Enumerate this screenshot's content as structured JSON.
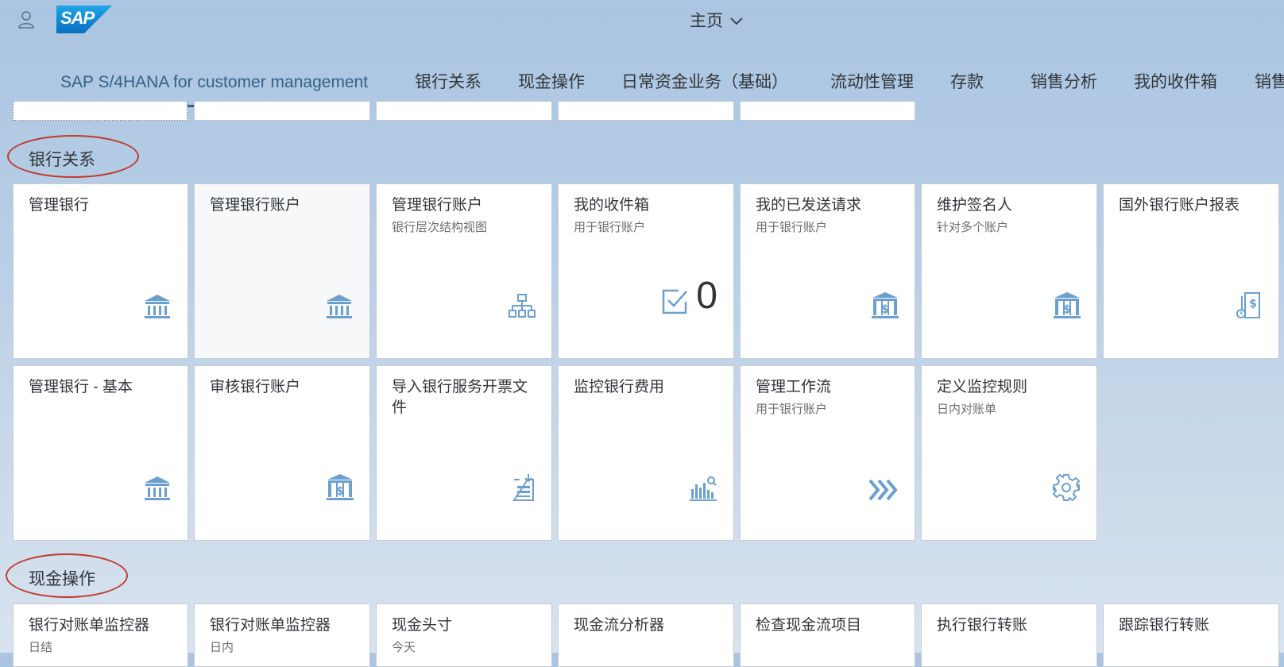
{
  "shell": {
    "logo_text": "SAP",
    "home_title": "主页"
  },
  "tabs": [
    {
      "label": "SAP S/4HANA for customer management",
      "active": true
    },
    {
      "label": "银行关系"
    },
    {
      "label": "现金操作"
    },
    {
      "label": "日常资金业务（基础）"
    },
    {
      "label": "流动性管理"
    },
    {
      "label": "存款"
    },
    {
      "label": "销售分析"
    },
    {
      "label": "我的收件箱"
    },
    {
      "label": "销售"
    }
  ],
  "groups": [
    {
      "title": "银行关系",
      "tiles": [
        {
          "title": "管理银行",
          "subtitle": "",
          "icon": "bank-icon"
        },
        {
          "title": "管理银行账户",
          "subtitle": "",
          "icon": "bank-icon"
        },
        {
          "title": "管理银行账户",
          "subtitle": "银行层次结构视图",
          "icon": "hierarchy-icon"
        },
        {
          "title": "我的收件箱",
          "subtitle": "用于银行账户",
          "icon": "checkbox-icon",
          "kpi": "0"
        },
        {
          "title": "我的已发送请求",
          "subtitle": "用于银行账户",
          "icon": "bank-dollar-icon"
        },
        {
          "title": "维护签名人",
          "subtitle": "针对多个账户",
          "icon": "bank-dollar-icon"
        },
        {
          "title": "国外银行账户报表",
          "subtitle": "",
          "icon": "document-dollar-icon"
        },
        {
          "title": "管理银行 - 基本",
          "subtitle": "",
          "icon": "bank-icon"
        },
        {
          "title": "审核银行账户",
          "subtitle": "",
          "icon": "bank-dollar-icon"
        },
        {
          "title": "导入银行服务开票文件",
          "subtitle": "",
          "icon": "document-import-icon"
        },
        {
          "title": "监控银行费用",
          "subtitle": "",
          "icon": "chart-search-icon"
        },
        {
          "title": "管理工作流",
          "subtitle": "用于银行账户",
          "icon": "chevrons-right-icon"
        },
        {
          "title": "定义监控规则",
          "subtitle": "日内对账单",
          "icon": "gear-icon"
        }
      ]
    },
    {
      "title": "现金操作",
      "tiles": [
        {
          "title": "银行对账单监控器",
          "subtitle": "日结"
        },
        {
          "title": "银行对账单监控器",
          "subtitle": "日内"
        },
        {
          "title": "现金头寸",
          "subtitle": "今天"
        },
        {
          "title": "现金流分析器",
          "subtitle": ""
        },
        {
          "title": "检查现金流项目",
          "subtitle": ""
        },
        {
          "title": "执行银行转账",
          "subtitle": ""
        },
        {
          "title": "跟踪银行转账",
          "subtitle": ""
        }
      ]
    }
  ],
  "colors": {
    "accent": "#346187",
    "icon": "#6a9fd0",
    "annotation": "#c0392b"
  }
}
